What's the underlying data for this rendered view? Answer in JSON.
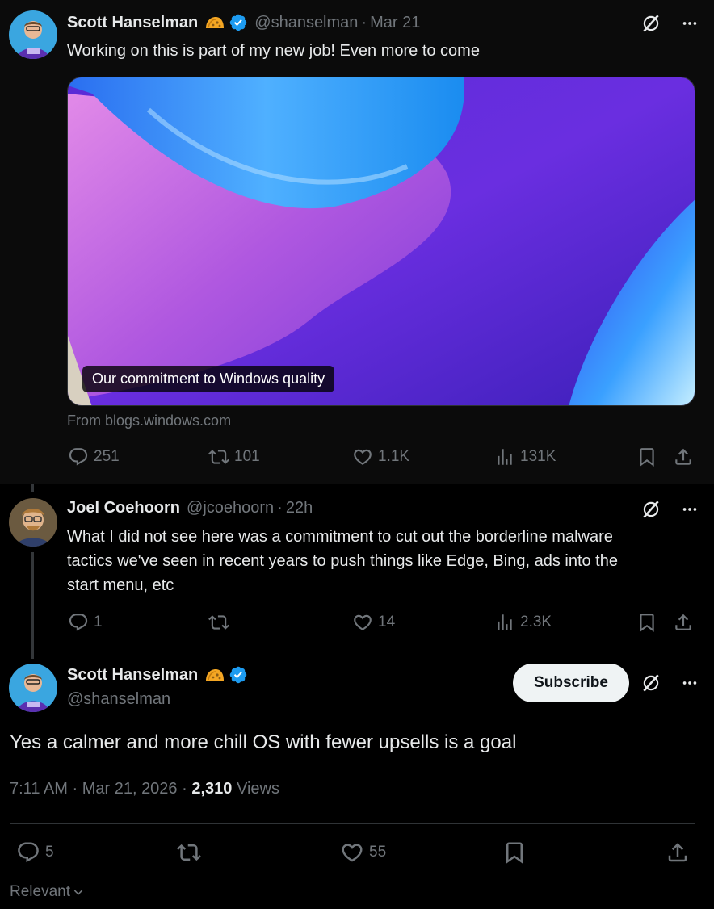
{
  "tweet1": {
    "name": "Scott Hanselman",
    "handle": "@shanselman",
    "sep": "·",
    "date": "Mar 21",
    "text": "Working on this is part of my new job! Even more to come",
    "card": {
      "caption": "Our commitment to Windows quality",
      "source": "From blogs.windows.com"
    },
    "actions": {
      "replies": "251",
      "reposts": "101",
      "likes": "1.1K",
      "views": "131K"
    }
  },
  "tweet2": {
    "name": "Joel Coehoorn",
    "handle": "@jcoehoorn",
    "sep": "·",
    "date": "22h",
    "text_lines": [
      "What I did not see here was a commitment to cut out the borderline malware",
      "tactics we've seen in recent years to push things like Edge, Bing, ads into the",
      "start menu, etc"
    ],
    "actions": {
      "replies": "1",
      "reposts": "",
      "likes": "14",
      "views": "2.3K"
    }
  },
  "main": {
    "name": "Scott Hanselman",
    "handle": "@shanselman",
    "subscribe_label": "Subscribe",
    "text": "Yes a calmer and more chill OS with fewer upsells is a goal",
    "time": "7:11 AM",
    "sep": "·",
    "date": "Mar 21, 2026",
    "views_count": "2,310",
    "views_label": "Views",
    "actions": {
      "replies": "5",
      "likes": "55"
    }
  },
  "sort": {
    "label": "Relevant"
  },
  "colors": {
    "background": "#000000",
    "text": "#e7e9ea",
    "muted": "#71767b",
    "verified": "#1d9bf0",
    "line": "#333639"
  },
  "icons": [
    "grok-icon",
    "more-icon",
    "reply-icon",
    "repost-icon",
    "like-icon",
    "views-icon",
    "bookmark-icon",
    "share-icon",
    "verified-icon",
    "taco-badge-icon",
    "chevron-down-icon"
  ]
}
